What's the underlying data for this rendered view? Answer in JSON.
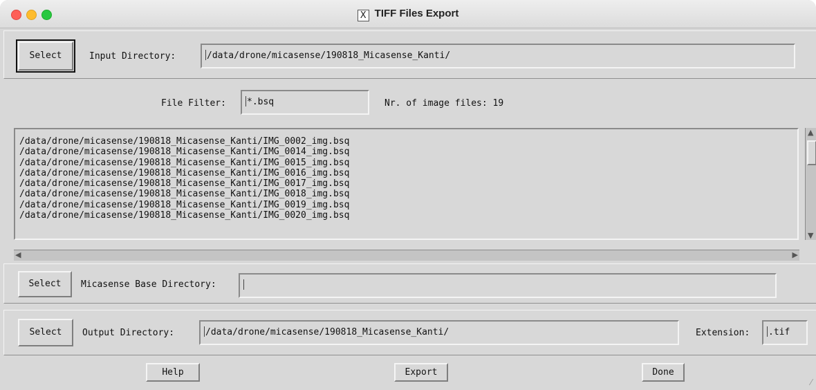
{
  "window": {
    "title": "TIFF Files Export",
    "x_icon_glyph": "X"
  },
  "input": {
    "select_label": "Select",
    "label": "Input Directory:",
    "value": "/data/drone/micasense/190818_Micasense_Kanti/"
  },
  "filter": {
    "label": "File Filter:",
    "value": "*.bsq",
    "count_label": "Nr. of image files: 19"
  },
  "file_list": [
    "/data/drone/micasense/190818_Micasense_Kanti/IMG_0002_img.bsq",
    "/data/drone/micasense/190818_Micasense_Kanti/IMG_0014_img.bsq",
    "/data/drone/micasense/190818_Micasense_Kanti/IMG_0015_img.bsq",
    "/data/drone/micasense/190818_Micasense_Kanti/IMG_0016_img.bsq",
    "/data/drone/micasense/190818_Micasense_Kanti/IMG_0017_img.bsq",
    "/data/drone/micasense/190818_Micasense_Kanti/IMG_0018_img.bsq",
    "/data/drone/micasense/190818_Micasense_Kanti/IMG_0019_img.bsq",
    "/data/drone/micasense/190818_Micasense_Kanti/IMG_0020_img.bsq"
  ],
  "base": {
    "select_label": "Select",
    "label": "Micasense Base Directory:",
    "value": ""
  },
  "output": {
    "select_label": "Select",
    "label": "Output Directory:",
    "value": "/data/drone/micasense/190818_Micasense_Kanti/",
    "ext_label": "Extension:",
    "ext_value": ".tif"
  },
  "actions": {
    "help": "Help",
    "export": "Export",
    "done": "Done"
  },
  "colors": {
    "close": "#fe5f57",
    "minimize": "#febc2e",
    "maximize": "#28c840",
    "panel": "#d8d8d8"
  }
}
